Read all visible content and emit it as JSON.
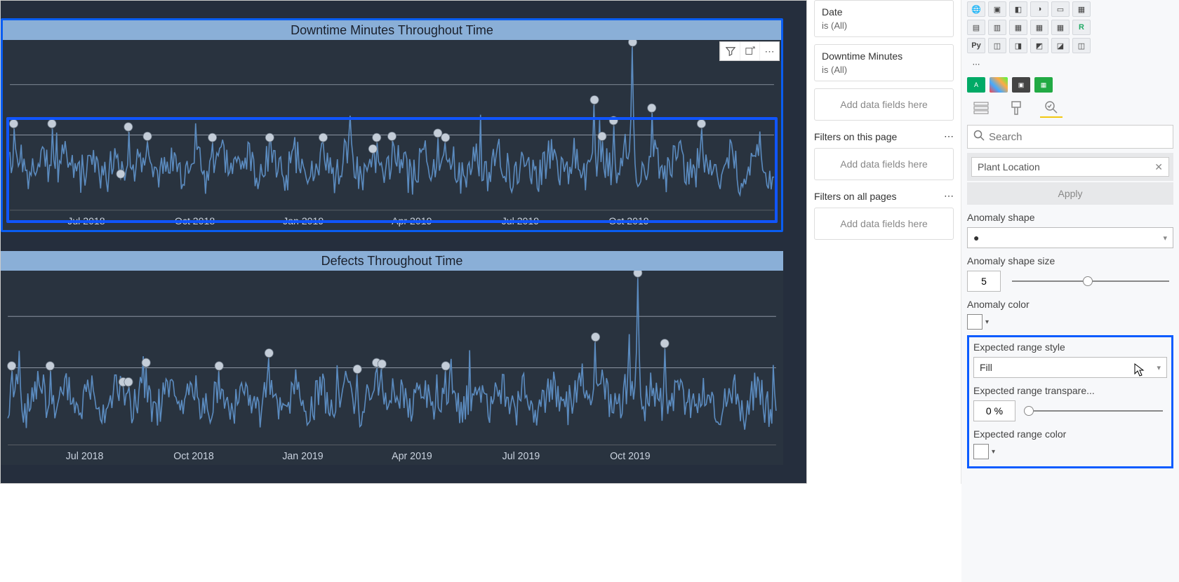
{
  "charts": [
    {
      "title": "Downtime Minutes Throughout Time",
      "selected": true,
      "toolbar": true
    },
    {
      "title": "Defects Throughout Time",
      "selected": false,
      "toolbar": false
    }
  ],
  "chart_data": [
    {
      "type": "line",
      "title": "Downtime Minutes Throughout Time",
      "xlabel": "",
      "ylabel": "",
      "x_ticks": [
        "Jul 2018",
        "Oct 2018",
        "Jan 2019",
        "Apr 2019",
        "Jul 2019",
        "Oct 2019"
      ],
      "ylim": [
        0,
        260
      ],
      "baseline_mean": 70,
      "series": [
        {
          "name": "Downtime Minutes",
          "note": "daily values oscillating roughly between 20 and 120 with occasional spikes to ~150-260"
        }
      ],
      "anomalies": [
        {
          "x_pct": 0.5,
          "y": 130
        },
        {
          "x_pct": 5.5,
          "y": 130
        },
        {
          "x_pct": 15.5,
          "y": 125
        },
        {
          "x_pct": 14.5,
          "y": 50
        },
        {
          "x_pct": 18,
          "y": 110
        },
        {
          "x_pct": 26.5,
          "y": 108
        },
        {
          "x_pct": 34,
          "y": 108
        },
        {
          "x_pct": 41,
          "y": 108
        },
        {
          "x_pct": 48,
          "y": 108
        },
        {
          "x_pct": 47.5,
          "y": 90
        },
        {
          "x_pct": 50,
          "y": 110
        },
        {
          "x_pct": 56,
          "y": 115
        },
        {
          "x_pct": 57,
          "y": 108
        },
        {
          "x_pct": 76.5,
          "y": 168
        },
        {
          "x_pct": 77.5,
          "y": 110
        },
        {
          "x_pct": 79,
          "y": 135
        },
        {
          "x_pct": 81.5,
          "y": 260
        },
        {
          "x_pct": 84,
          "y": 155
        },
        {
          "x_pct": 90.5,
          "y": 130
        }
      ]
    },
    {
      "type": "line",
      "title": "Defects Throughout Time",
      "xlabel": "",
      "ylabel": "",
      "x_ticks": [
        "Jul 2018",
        "Oct 2018",
        "Jan 2019",
        "Apr 2019",
        "Jul 2019",
        "Oct 2019"
      ],
      "ylim": [
        0,
        260
      ],
      "baseline_mean": 70,
      "series": [
        {
          "name": "Defects",
          "note": "daily values oscillating roughly between 20 and 120 with occasional spikes to ~150-260"
        }
      ],
      "anomalies": [
        {
          "x_pct": 0.5,
          "y": 115
        },
        {
          "x_pct": 5.5,
          "y": 115
        },
        {
          "x_pct": 15,
          "y": 90
        },
        {
          "x_pct": 15.7,
          "y": 90
        },
        {
          "x_pct": 18,
          "y": 120
        },
        {
          "x_pct": 27.5,
          "y": 115
        },
        {
          "x_pct": 34,
          "y": 135
        },
        {
          "x_pct": 45.5,
          "y": 110
        },
        {
          "x_pct": 48,
          "y": 120
        },
        {
          "x_pct": 48.7,
          "y": 118
        },
        {
          "x_pct": 57,
          "y": 115
        },
        {
          "x_pct": 76.5,
          "y": 160
        },
        {
          "x_pct": 82,
          "y": 260
        },
        {
          "x_pct": 85.5,
          "y": 150
        }
      ]
    }
  ],
  "filters": {
    "card1": {
      "title": "Date",
      "sub": "is (All)"
    },
    "card2": {
      "title": "Downtime Minutes",
      "sub": "is (All)"
    },
    "add": "Add data fields here",
    "page_section": "Filters on this page",
    "all_section": "Filters on all pages"
  },
  "format": {
    "search_placeholder": "Search",
    "field_pill": "Plant Location",
    "apply": "Apply",
    "anomaly_shape_label": "Anomaly shape",
    "anomaly_shape_value": "●",
    "anomaly_size_label": "Anomaly shape size",
    "anomaly_size_value": "5",
    "anomaly_color_label": "Anomaly color",
    "expected_style_label": "Expected range style",
    "expected_style_value": "Fill",
    "expected_transp_label": "Expected range transpare...",
    "expected_transp_value": "0",
    "expected_transp_unit": "%",
    "expected_color_label": "Expected range color"
  },
  "viz_icons_row2": [
    "Py",
    "",
    "",
    "",
    "",
    ""
  ]
}
